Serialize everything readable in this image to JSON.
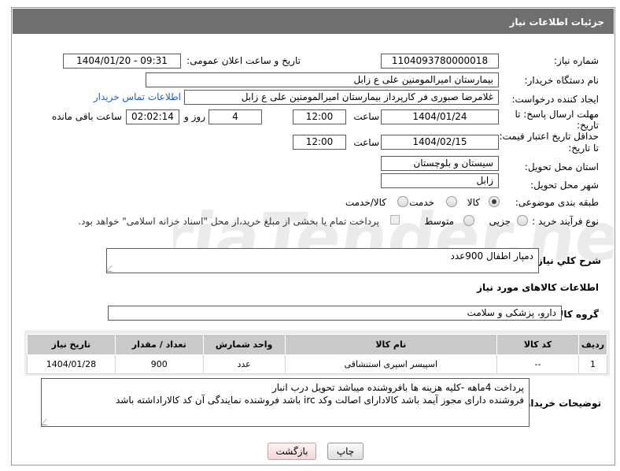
{
  "page": {
    "title": "جزئیات اطلاعات نیاز"
  },
  "fields": {
    "need_number": {
      "label": "شماره نیاز:",
      "value": "1104093780000018"
    },
    "announce_datetime": {
      "label": "تاریخ و ساعت اعلان عمومی:",
      "value": "1404/01/20 - 09:31"
    },
    "buyer_org": {
      "label": "نام دستگاه خریدار:",
      "value": "بیمارستان امیرالمومنین علی  ع  زابل"
    },
    "requester": {
      "label": "ایجاد کننده درخواست:",
      "value": "غلامرضا صبوری فر کارپرداز بیمارستان امیرالمومنین علی  ع  زابل",
      "contact_link": "اطلاعات تماس خریدار"
    },
    "reply_deadline": {
      "label_line1": "مهلت ارسال پاسخ: تا",
      "label_line2": "تاریخ:",
      "date": "1404/01/24",
      "time_label": "ساعت",
      "time": "12:00",
      "days": "4",
      "days_label": "روز و",
      "remaining": "02:02:14",
      "remaining_label": "ساعت باقی مانده"
    },
    "price_validity": {
      "label_line1": "حداقل تاریخ اعتبار قیمت:",
      "label_line2": "تا تاریخ:",
      "date": "1404/02/15",
      "time_label": "ساعت",
      "time": "12:00"
    },
    "province": {
      "label": "استان محل تحویل:",
      "value": "سیستان و بلوچستان"
    },
    "city": {
      "label": "شهر محل تحویل:",
      "value": "زابل"
    },
    "category": {
      "label": "طبقه بندی موضوعی:",
      "options": [
        "کالا",
        "خدمت",
        "کالا/خدمت"
      ],
      "selected": "کالا"
    },
    "process_type": {
      "label": "نوع فرآیند خرید :",
      "options": [
        "جزیی",
        "متوسط"
      ],
      "selected": "",
      "payment_note": "پرداخت تمام یا بخشی از مبلغ خرید،از محل \"اسناد خزانه اسلامی\" خواهد بود."
    }
  },
  "description": {
    "label": "شرح کلي نياز:",
    "value": "دمپار اطفال 900عدد"
  },
  "items_section": {
    "title": "اطلاعات کالاهای مورد نیاز",
    "group_label": "گروه کالا:",
    "group_value": "دارو، پزشکی و سلامت",
    "columns": [
      "ردیف",
      "کد کالا",
      "نام کالا",
      "واحد شمارش",
      "تعداد / مقدار",
      "تاریخ نیاز"
    ],
    "rows": [
      [
        "1",
        "--",
        "اسپیسر اسپری استنشاقی",
        "عدد",
        "900",
        "1404/01/28"
      ]
    ]
  },
  "buyer_notes": {
    "label": "توضیحات خریدار:",
    "line1": "پرداخت 4ماهه -کلیه هزینه ها بافروشنده میباشد تحویل درب انبار",
    "line2": "فروشنده دارای مجوز آیمد باشد کالادارای اصالت وکد irc باشد فروشنده نمایندگی آن کد کالاراداشته باشد"
  },
  "buttons": {
    "print": "چاپ",
    "back": "بازگشت"
  },
  "watermark": {
    "text": "AriaTender.neT"
  },
  "colors": {
    "titlebar": "#6f6f6f",
    "link": "#1f5fbf",
    "table_header": "#c9c9c9",
    "back_button": "#f1d6d6"
  }
}
